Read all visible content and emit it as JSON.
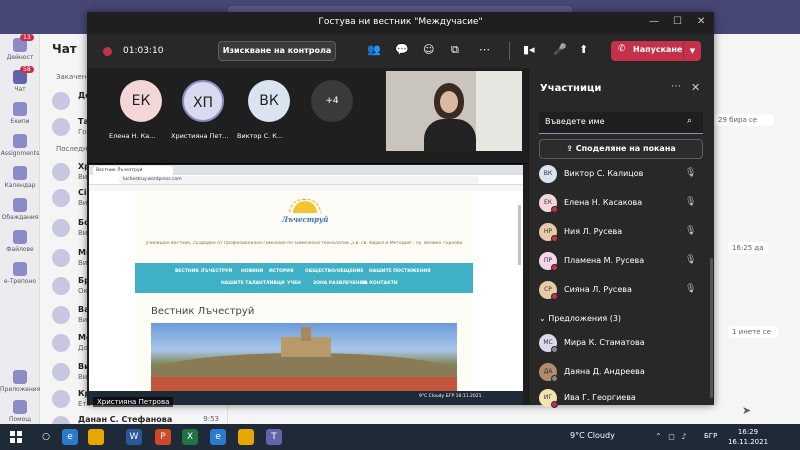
{
  "meeting": {
    "title": "Гостува ни вестник \"Междучасие\"",
    "timer": "01:03:10",
    "request_control_label": "Изискване на контрола",
    "leave_label": "Напускане"
  },
  "tiles": [
    {
      "initials": "ЕК",
      "name": "Елена Н. Ка...",
      "color": "#f3d6d8"
    },
    {
      "initials": "ХП",
      "name": "Християна Пет...",
      "color": "#d9d9ef"
    },
    {
      "initials": "ВК",
      "name": "Виктор С. К...",
      "color": "#d9e4f0"
    }
  ],
  "more_count": "+4",
  "presenter": "Християна Петрова",
  "shared_screen": {
    "tab_title": "Вестник Лъчезтруй",
    "url": "luchestruy.wordpress.com",
    "logo_text": "Лъчеструй",
    "tagline": "училищен вестник, създаден от Професионална гимназия по химически технологии „Св. св. Кирил и Методий“, гр. Велико Търново",
    "nav": [
      "ВЕСТНИК ЛЪЧЕСТРУЙ",
      "НОВИНИ",
      "ИСТОРИЯ",
      "ОБЩЕСТВО/ОБЩЕНИЕ",
      "НАШИТЕ ПОСТИЖЕНИЯ",
      "НАШИТЕ ТАЛАНТЛИВЦИ",
      "УЧЕН",
      "ЗОНА РАЗВЛЕЧЕНИЯ",
      "ЗА КОНТАКТИ"
    ],
    "heading": "Вестник Лъчеструй",
    "mini_tray": "9°C Cloudy  БГР  16:11.2021"
  },
  "panel": {
    "title": "Участници",
    "search_placeholder": "Въведете име",
    "share_invite_label": "Споделяне на покана",
    "participants": [
      {
        "initials": "ВК",
        "name": "Виктор С. Калицов",
        "color": "#d9e4f0"
      },
      {
        "initials": "ЕК",
        "name": "Елена Н. Касакова",
        "color": "#f3d6d8"
      },
      {
        "initials": "НР",
        "name": "Ния Л. Русева",
        "color": "#e8c9a8"
      },
      {
        "initials": "ПР",
        "name": "Пламена М. Русева",
        "color": "#f3d6e8"
      },
      {
        "initials": "СР",
        "name": "Сияна Л. Русева",
        "color": "#e8c9a8"
      }
    ],
    "suggestions_header": "Предложения (3)",
    "suggestions": [
      {
        "initials": "МС",
        "name": "Мира К. Стаматова",
        "color": "#d9d9ef"
      },
      {
        "initials": "ДА",
        "name": "Даяна Д. Андреева",
        "color": "#b48a6a"
      },
      {
        "initials": "ИГ",
        "name": "Ива Г. Георгиева",
        "color": "#f3e3b0"
      }
    ]
  },
  "rail": [
    {
      "label": "Дейност",
      "badge": "13"
    },
    {
      "label": "Чат",
      "badge": "58"
    },
    {
      "label": "Екипи",
      "badge": ""
    },
    {
      "label": "Assignments",
      "badge": ""
    },
    {
      "label": "Календар",
      "badge": ""
    },
    {
      "label": "Обаждания",
      "badge": ""
    },
    {
      "label": "Файлове",
      "badge": ""
    },
    {
      "label": "е-Трепоно",
      "badge": ""
    },
    {
      "label": "Приложения",
      "badge": ""
    },
    {
      "label": "Помощ",
      "badge": ""
    }
  ],
  "chatlist": {
    "title": "Чат",
    "pinned": "Закачено",
    "recent": "Последни",
    "rows": [
      {
        "name": "Дел",
        "sub": "",
        "time": ""
      },
      {
        "name": "Тан",
        "sub": "Гос",
        "time": ""
      },
      {
        "name": "Хри",
        "sub": "Вие",
        "time": ""
      },
      {
        "name": "Сія",
        "sub": "Вие",
        "time": ""
      },
      {
        "name": "Бог",
        "sub": "Вие",
        "time": ""
      },
      {
        "name": "Ми",
        "sub": "Вие",
        "time": ""
      },
      {
        "name": "Бре",
        "sub": "Ок",
        "time": ""
      },
      {
        "name": "Вас",
        "sub": "Вие",
        "time": ""
      },
      {
        "name": "Ме",
        "sub": "Доб",
        "time": ""
      },
      {
        "name": "Вие",
        "sub": "Вие",
        "time": ""
      },
      {
        "name": "Кри",
        "sub": "Ето",
        "time": ""
      },
      {
        "name": "Данан С. Стефанова",
        "sub": "",
        "time": "9:53"
      }
    ]
  },
  "chat_bubbles": [
    {
      "text": "29 бира се"
    },
    {
      "text": "16:25 да"
    },
    {
      "text": "1 инете се"
    }
  ],
  "taskbar": {
    "weather": "9°C  Cloudy",
    "lang": "БГР",
    "time": "16:29",
    "date": "16.11.2021 г."
  }
}
